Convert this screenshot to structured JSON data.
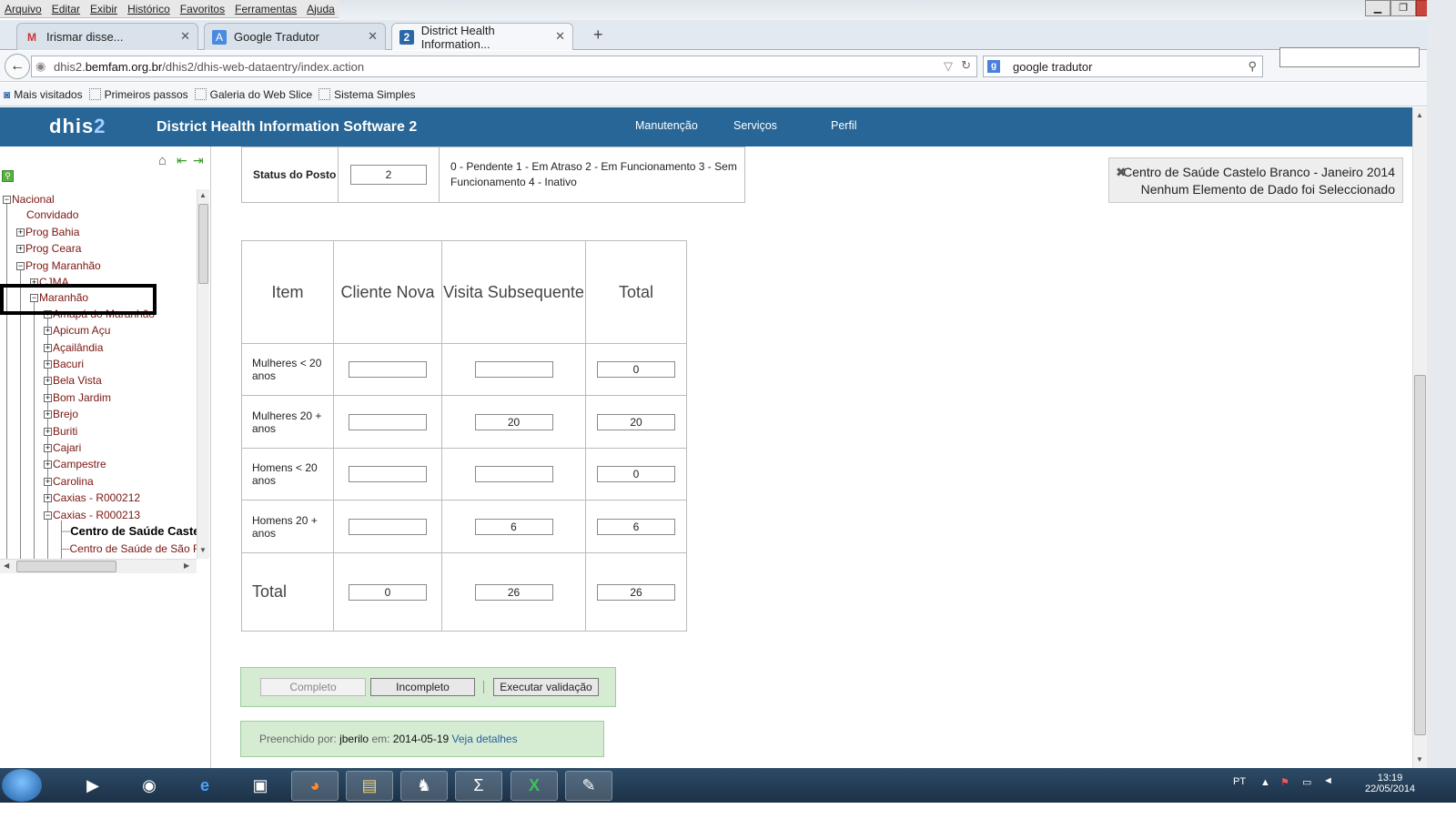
{
  "menubar": [
    "Arquivo",
    "Editar",
    "Exibir",
    "Histórico",
    "Favoritos",
    "Ferramentas",
    "Ajuda"
  ],
  "tabs": [
    {
      "label": "Irismar disse...",
      "icon": "gmail-icon"
    },
    {
      "label": "Google Tradutor",
      "icon": "translate-icon"
    },
    {
      "label": "District Health Information...",
      "icon": "dhis-icon"
    }
  ],
  "url": {
    "prefix": "dhis2.",
    "domain": "bemfam.org.br",
    "path": "/dhis2/dhis-web-dataentry/index.action"
  },
  "search": {
    "value": "google tradutor"
  },
  "bookmarks": [
    "Mais visitados",
    "Primeiros passos",
    "Galeria do Web Slice",
    "Sistema Simples"
  ],
  "app": {
    "logo_a": "dhis",
    "logo_b": "2",
    "title": "District Health Information Software 2",
    "menu": [
      "Manutenção",
      "Serviços",
      "Perfil"
    ]
  },
  "tree": [
    {
      "label": "Nacional",
      "pm": "−"
    },
    {
      "label": "Convidado",
      "pm": ""
    },
    {
      "label": "Prog Bahia",
      "pm": "+"
    },
    {
      "label": "Prog Ceara",
      "pm": "+"
    },
    {
      "label": "Prog Maranhão",
      "pm": "−"
    },
    {
      "label": "CJMA",
      "pm": "+"
    },
    {
      "label": "Maranhão",
      "pm": "−"
    },
    {
      "label": "Amapá do Maranhão",
      "pm": "+"
    },
    {
      "label": "Apicum Açu",
      "pm": "+"
    },
    {
      "label": "Açailândia",
      "pm": "+"
    },
    {
      "label": "Bacuri",
      "pm": "+"
    },
    {
      "label": "Bela Vista",
      "pm": "+"
    },
    {
      "label": "Bom Jardim",
      "pm": "+"
    },
    {
      "label": "Brejo",
      "pm": "+"
    },
    {
      "label": "Buriti",
      "pm": "+"
    },
    {
      "label": "Cajari",
      "pm": "+"
    },
    {
      "label": "Campestre",
      "pm": "+"
    },
    {
      "label": "Carolina",
      "pm": "+"
    },
    {
      "label": "Caxias - R000212",
      "pm": "+"
    },
    {
      "label": "Caxias - R000213",
      "pm": "−"
    },
    {
      "label": "Centro de Saúde Castelo Branco",
      "pm": ""
    },
    {
      "label": "Centro de Saúde de São Francisco",
      "pm": ""
    }
  ],
  "status": {
    "label": "Status do Posto",
    "value": "2",
    "legend": "0 - Pendente   1 - Em Atraso   2 - Em Funcionamento  3 - Sem Funcionamento  4 - Inativo"
  },
  "table": {
    "headers": [
      "Item",
      "Cliente Nova",
      "Visita Subsequente",
      "Total"
    ],
    "rows": [
      {
        "label": "Mulheres < 20 anos",
        "nova": "",
        "visita": "",
        "total": "0"
      },
      {
        "label": "Mulheres 20 + anos",
        "nova": "",
        "visita": "20",
        "total": "20"
      },
      {
        "label": "Homens < 20 anos",
        "nova": "",
        "visita": "",
        "total": "0"
      },
      {
        "label": "Homens 20 + anos",
        "nova": "",
        "visita": "6",
        "total": "6"
      }
    ],
    "total": {
      "label": "Total",
      "nova": "0",
      "visita": "26",
      "total": "26"
    }
  },
  "notice": {
    "line1": "Centro de Saúde Castelo Branco - Janeiro 2014",
    "line2": "Nenhum Elemento de Dado foi Seleccionado"
  },
  "buttons": {
    "complete": "Completo",
    "incomplete": "Incompleto",
    "validate": "Executar validação"
  },
  "info": {
    "filled_by_label": "Preenchido por:",
    "user": "jberilo",
    "on_label": "em:",
    "date": "2014-05-19",
    "details_link": "Veja detalhes"
  },
  "tray": {
    "lang": "PT",
    "time": "13:19",
    "date": "22/05/2014"
  }
}
